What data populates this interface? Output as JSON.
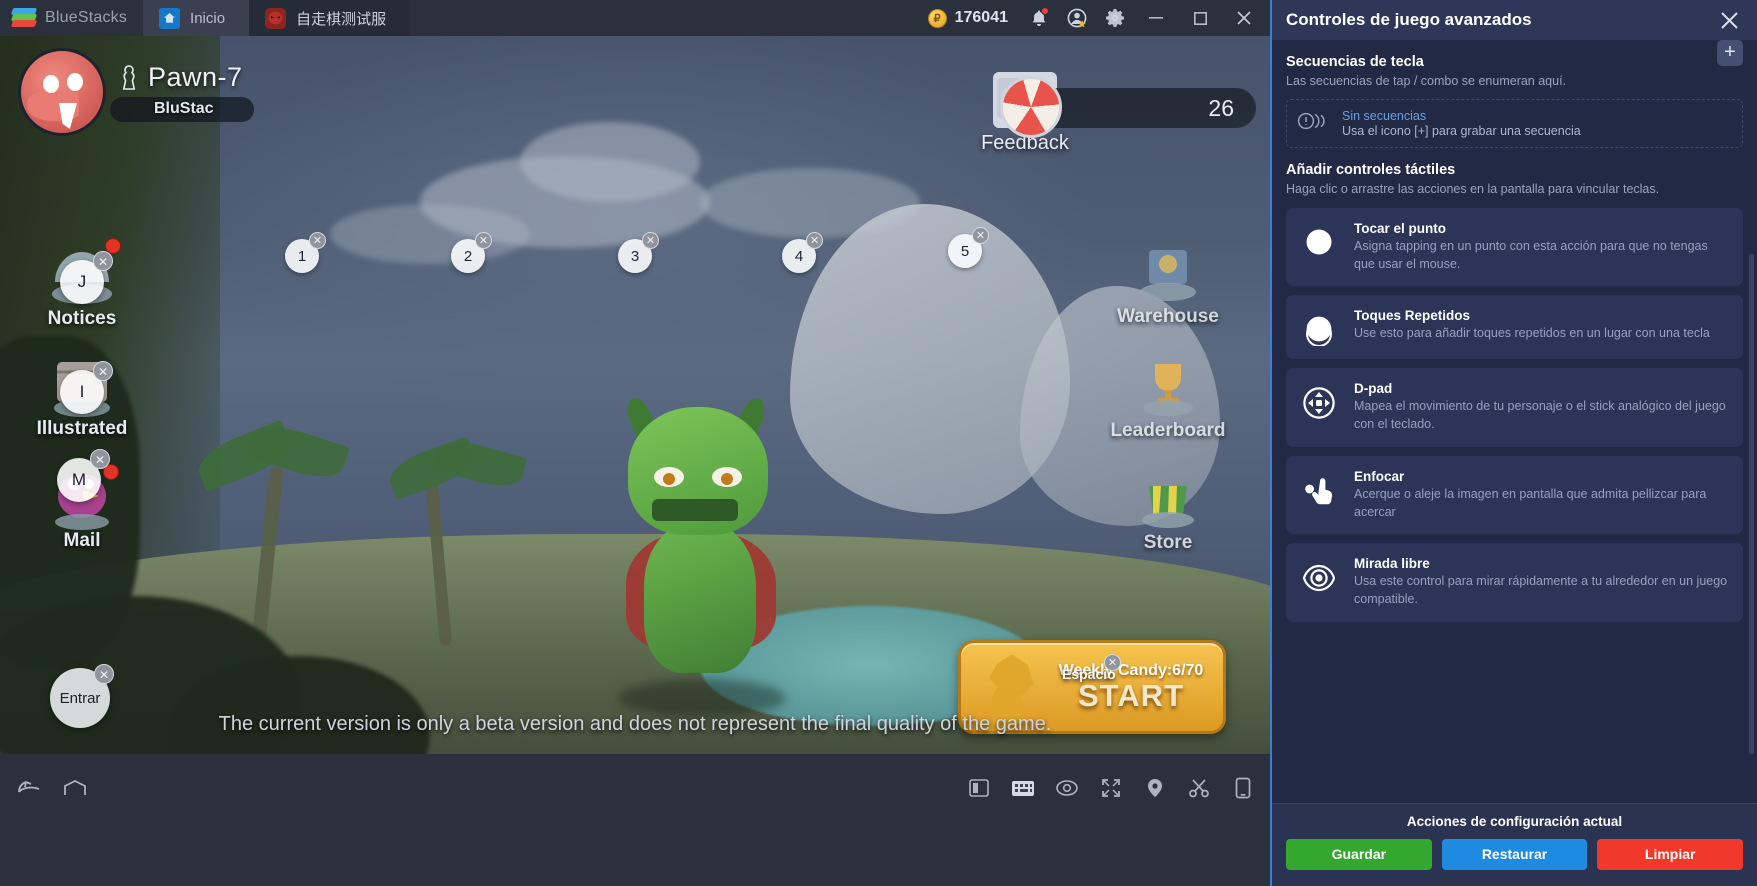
{
  "titlebar": {
    "brand": "BlueStacks",
    "tabs": [
      {
        "label": "Inicio",
        "icon": "home-icon"
      },
      {
        "label": "自走棋测试服",
        "icon": "game-icon"
      }
    ],
    "coins": "176041",
    "coin_symbol": "₽",
    "icons": [
      "bell-icon",
      "account-star-icon",
      "gear-icon"
    ],
    "window_controls": {
      "minimize": "—",
      "maximize": "▢",
      "close": "✕"
    }
  },
  "game": {
    "player_name": "Pawn-7",
    "clan_tag": "BluStac",
    "feedback_label": "Feedback",
    "gem_count": "26",
    "left_menu": [
      {
        "label": "Notices",
        "key": "J",
        "badge": true
      },
      {
        "label": "Illustrated",
        "key": "I",
        "badge": false
      },
      {
        "label": "Mail",
        "key": "M",
        "badge": true
      }
    ],
    "right_menu": [
      {
        "label": "Warehouse"
      },
      {
        "label": "Leaderboard"
      },
      {
        "label": "Store"
      }
    ],
    "tap_points": [
      "1",
      "2",
      "3",
      "4",
      "5"
    ],
    "entrar_label": "Entrar",
    "espacio_label": "Espacio",
    "start_button": {
      "candy": "Weekly Candy:6/70",
      "label": "START"
    },
    "beta_note": "The current version is only a beta version and does not represent the final quality of the game.",
    "remove_glyph": "✕"
  },
  "bottombar": {
    "left_icons": [
      "back-icon",
      "home-icon"
    ],
    "right_icons": [
      "multi-instance-icon",
      "keyboard-icon",
      "eye-icon",
      "fullscreen-icon",
      "location-icon",
      "scissors-icon",
      "rotate-device-icon"
    ]
  },
  "panel": {
    "title": "Controles de juego avanzados",
    "close_glyph": "✕",
    "sequences": {
      "title": "Secuencias de tecla",
      "subtitle": "Las secuencias de tap / combo se enumeran aquí.",
      "add_glyph": "+",
      "empty_title": "Sin secuencias",
      "empty_desc": "Usa el icono [+] para grabar una secuencia"
    },
    "touch_controls": {
      "title": "Añadir controles táctiles",
      "subtitle": "Haga clic o arrastre las acciones en la pantalla para vincular teclas."
    },
    "cards": [
      {
        "icon": "tap-point-icon",
        "title": "Tocar el punto",
        "desc": "Asigna tapping en un punto con esta acción para que no tengas que usar el mouse."
      },
      {
        "icon": "repeated-tap-icon",
        "title": "Toques Repetidos",
        "desc": "Use esto para añadir toques repetidos en un lugar con una tecla"
      },
      {
        "icon": "dpad-icon",
        "title": "D-pad",
        "desc": "Mapea el movimiento de tu personaje o el stick analógico del juego con el teclado."
      },
      {
        "icon": "pinch-zoom-icon",
        "title": "Enfocar",
        "desc": "Acerque o aleje la imagen en pantalla que admita pellizcar para acercar"
      },
      {
        "icon": "free-look-icon",
        "title": "Mirada libre",
        "desc": "Usa este control para mirar rápidamente a tu alrededor en un juego compatible."
      }
    ],
    "footer": {
      "title": "Acciones de configuración actual",
      "save": "Guardar",
      "restore": "Restaurar",
      "clear": "Limpiar",
      "save_color": "#34a82e",
      "restore_color": "#1e8ae0",
      "clear_color": "#f0392b"
    }
  }
}
